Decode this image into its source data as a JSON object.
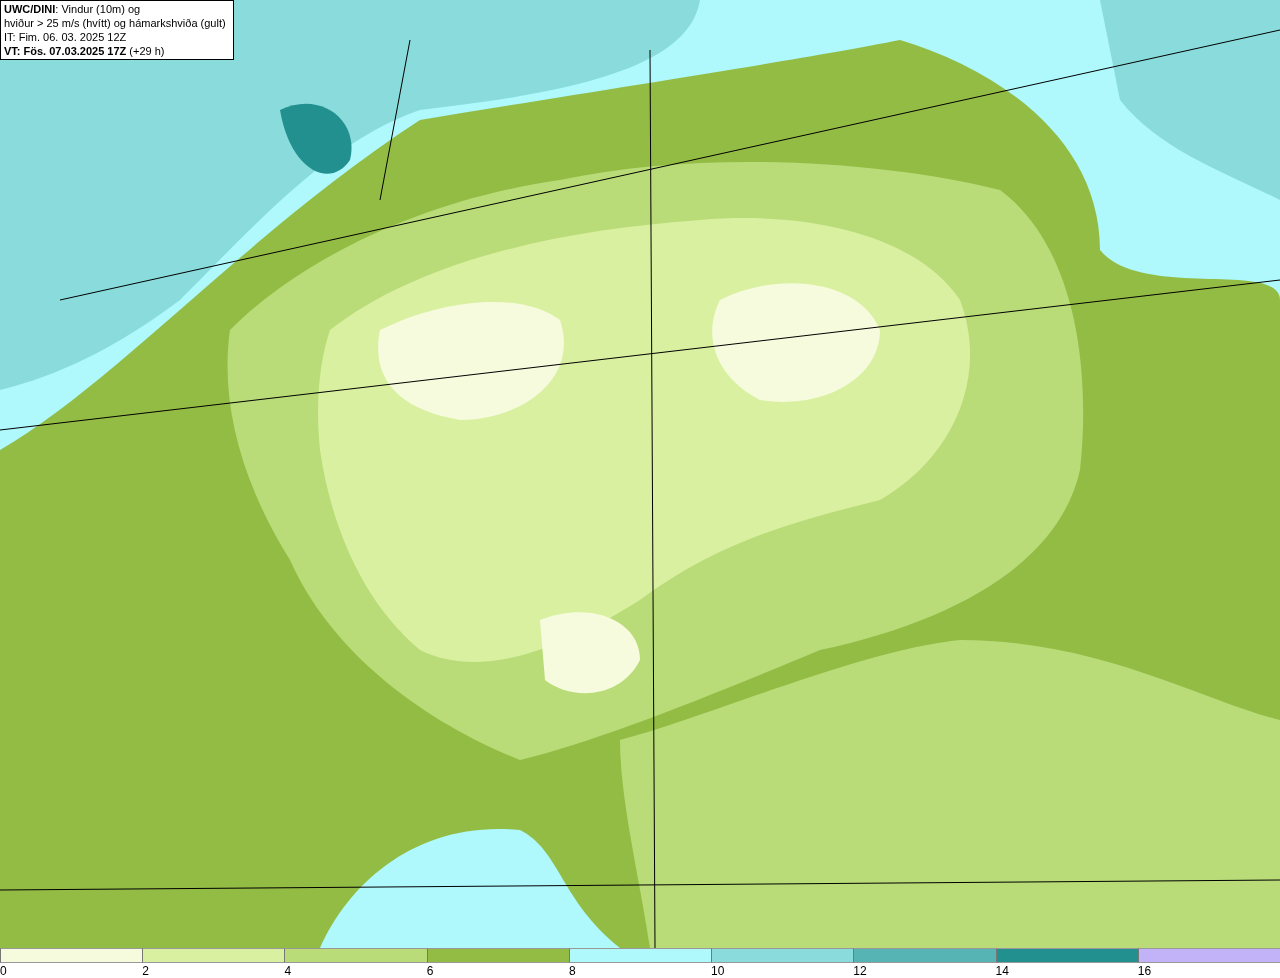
{
  "title_box": {
    "lines": [
      "**UWC/DINI**: Vindur (10m) og",
      "hviður > 25 m/s (hvítt) og hámarkshviða (gult)",
      "IT: Fim. 06. 03. 2025 12Z",
      "**VT: Fös. 07.03.2025 17Z** (+29 h)"
    ]
  },
  "legend": [
    {
      "label": "0",
      "color": "#f5fbdc"
    },
    {
      "label": "2",
      "color": "#d9f0a0"
    },
    {
      "label": "4",
      "color": "#b9dc78"
    },
    {
      "label": "6",
      "color": "#93bc45"
    },
    {
      "label": "8",
      "color": "#aff8fc"
    },
    {
      "label": "10",
      "color": "#8adcdc"
    },
    {
      "label": "12",
      "color": "#56b4b4"
    },
    {
      "label": "14",
      "color": "#239090"
    },
    {
      "label": "16",
      "color": "#c2b2f7"
    }
  ]
}
